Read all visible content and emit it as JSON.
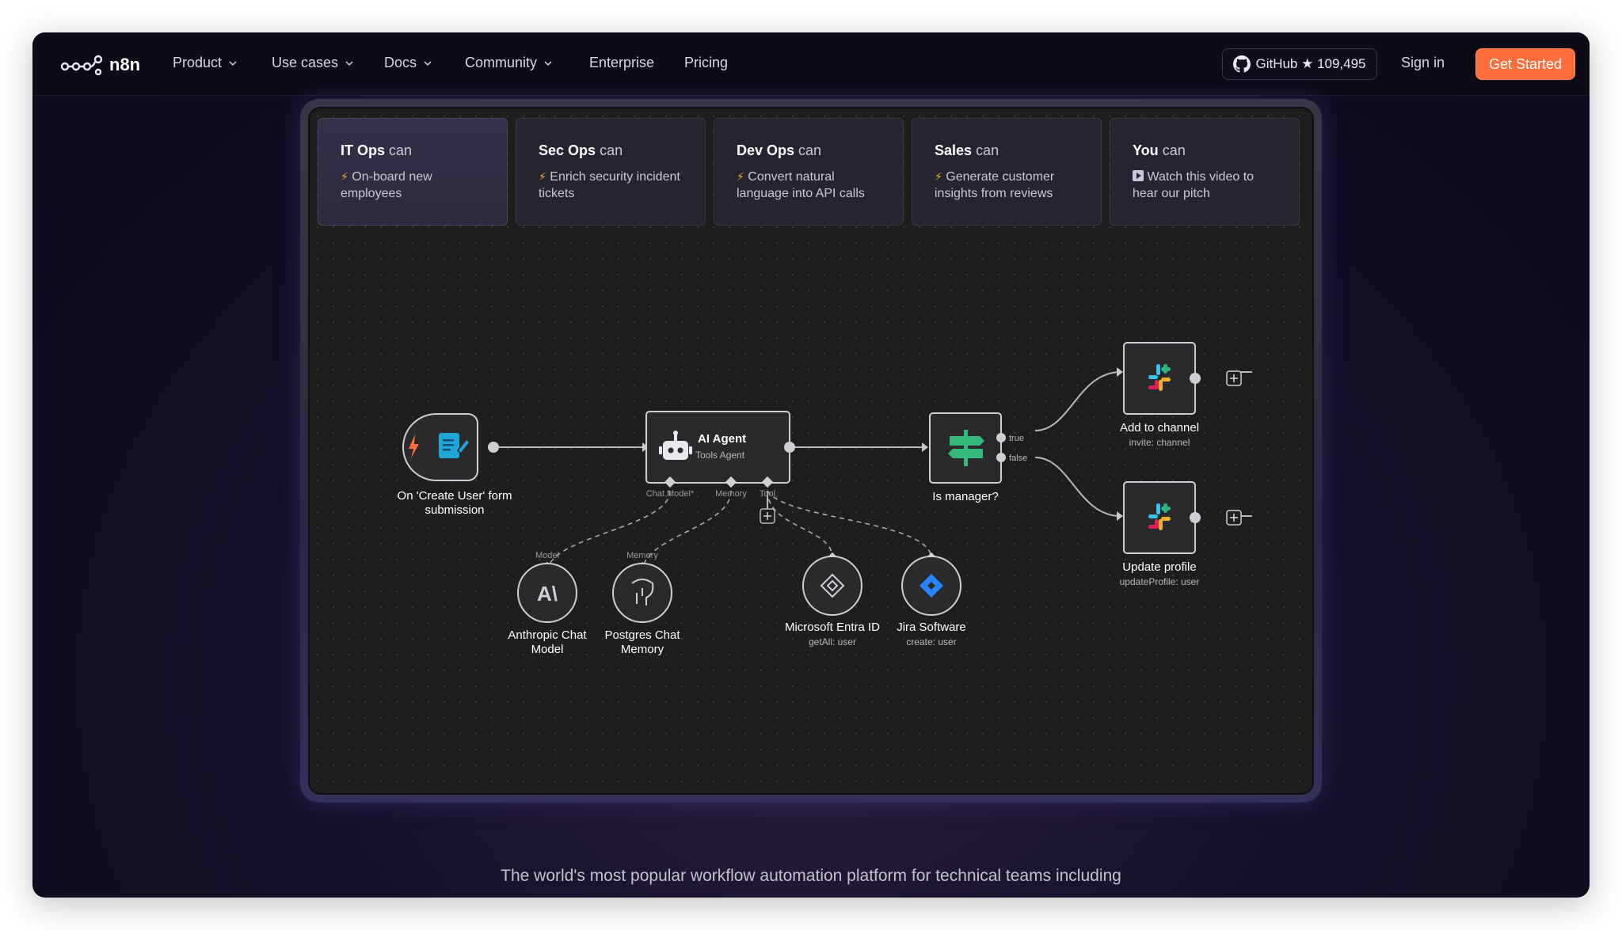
{
  "nav": {
    "logo": "n8n",
    "items": [
      {
        "label": "Product",
        "dropdown": true
      },
      {
        "label": "Use cases",
        "dropdown": true
      },
      {
        "label": "Docs",
        "dropdown": true
      },
      {
        "label": "Community",
        "dropdown": true
      },
      {
        "label": "Enterprise",
        "dropdown": false
      },
      {
        "label": "Pricing",
        "dropdown": false
      }
    ],
    "github": "GitHub ★ 109,495",
    "signin": "Sign in",
    "cta": "Get Started"
  },
  "tabs": [
    {
      "role": "IT Ops",
      "can": "can",
      "desc": "On-board new employees",
      "icon": "bolt-icon",
      "active": true
    },
    {
      "role": "Sec Ops",
      "can": "can",
      "desc": "Enrich security incident tickets",
      "icon": "bolt-icon",
      "active": false
    },
    {
      "role": "Dev Ops",
      "can": "can",
      "desc": "Convert natural language into API calls",
      "icon": "bolt-icon",
      "active": false
    },
    {
      "role": "Sales",
      "can": "can",
      "desc": "Generate customer insights from reviews",
      "icon": "bolt-icon",
      "active": false
    },
    {
      "role": "You",
      "can": "can",
      "desc": "Watch this video to hear our pitch",
      "icon": "play-icon",
      "active": false
    }
  ],
  "workflow": {
    "trigger": {
      "label": "On 'Create User' form",
      "label2": "submission"
    },
    "agent": {
      "title": "AI Agent",
      "subtitle": "Tools Agent",
      "ports": [
        "Chat Model*",
        "Memory",
        "Tool"
      ]
    },
    "ifnode": {
      "label": "Is manager?",
      "true_label": "true",
      "false_label": "false"
    },
    "slack_top": {
      "label": "Add to channel",
      "sub": "invite: channel"
    },
    "slack_bottom": {
      "label": "Update profile",
      "sub": "updateProfile: user"
    },
    "anthropic": {
      "label": "Anthropic Chat",
      "label2": "Model",
      "port": "Model"
    },
    "postgres": {
      "label": "Postgres Chat",
      "label2": "Memory",
      "port": "Memory"
    },
    "entra": {
      "label": "Microsoft Entra ID",
      "sub": "getAll: user"
    },
    "jira": {
      "label": "Jira Software",
      "sub": "create: user"
    }
  },
  "tagline": "The world's most popular workflow automation platform for technical teams including",
  "colors": {
    "cta": "#ff6d3a",
    "slack_red": "#e01e5a",
    "slack_green": "#2eb67d",
    "slack_blue": "#36c5f0",
    "slack_yellow": "#ecb22e",
    "if_green": "#35b87a",
    "form_blue": "#1fa6d8",
    "jira_blue": "#2684ff"
  }
}
